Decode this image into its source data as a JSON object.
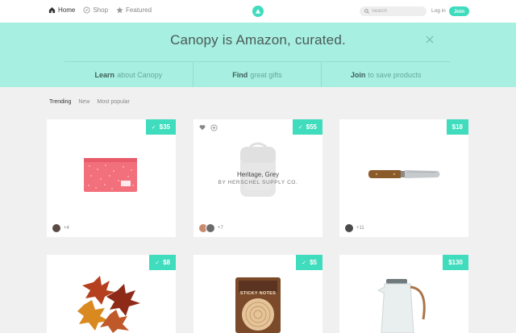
{
  "nav": {
    "items": [
      {
        "label": "Home",
        "icon": "home-icon",
        "active": true
      },
      {
        "label": "Shop",
        "icon": "compass-icon",
        "active": false
      },
      {
        "label": "Featured",
        "icon": "star-icon",
        "active": false
      }
    ],
    "search_placeholder": "Search",
    "login_label": "Log in",
    "join_label": "Join"
  },
  "hero": {
    "title": "Canopy is Amazon, curated.",
    "links": [
      {
        "strong": "Learn",
        "rest": "about Canopy"
      },
      {
        "strong": "Find",
        "rest": "great gifts"
      },
      {
        "strong": "Join",
        "rest": "to save products"
      }
    ]
  },
  "filters": [
    "Trending",
    "New",
    "Most popular"
  ],
  "products": [
    {
      "price": "$35",
      "checked": true,
      "count": "+4",
      "image": "pink-pouch"
    },
    {
      "price": "$55",
      "checked": true,
      "count": "+7",
      "image": "backpack",
      "overlay_title": "Heritage, Grey",
      "overlay_subtitle": "BY HERSCHEL SUPPLY CO."
    },
    {
      "price": "$18",
      "checked": false,
      "count": "+11",
      "image": "garden-knife"
    },
    {
      "price": "$8",
      "checked": true,
      "image": "autumn-leaves"
    },
    {
      "price": "$5",
      "checked": true,
      "image": "sticky-notes",
      "package_text": "STICKY NOTES"
    },
    {
      "price": "$130",
      "checked": false,
      "image": "kettle"
    }
  ],
  "colors": {
    "accent": "#3fdcbd",
    "hero_bg": "#a7efe0"
  }
}
